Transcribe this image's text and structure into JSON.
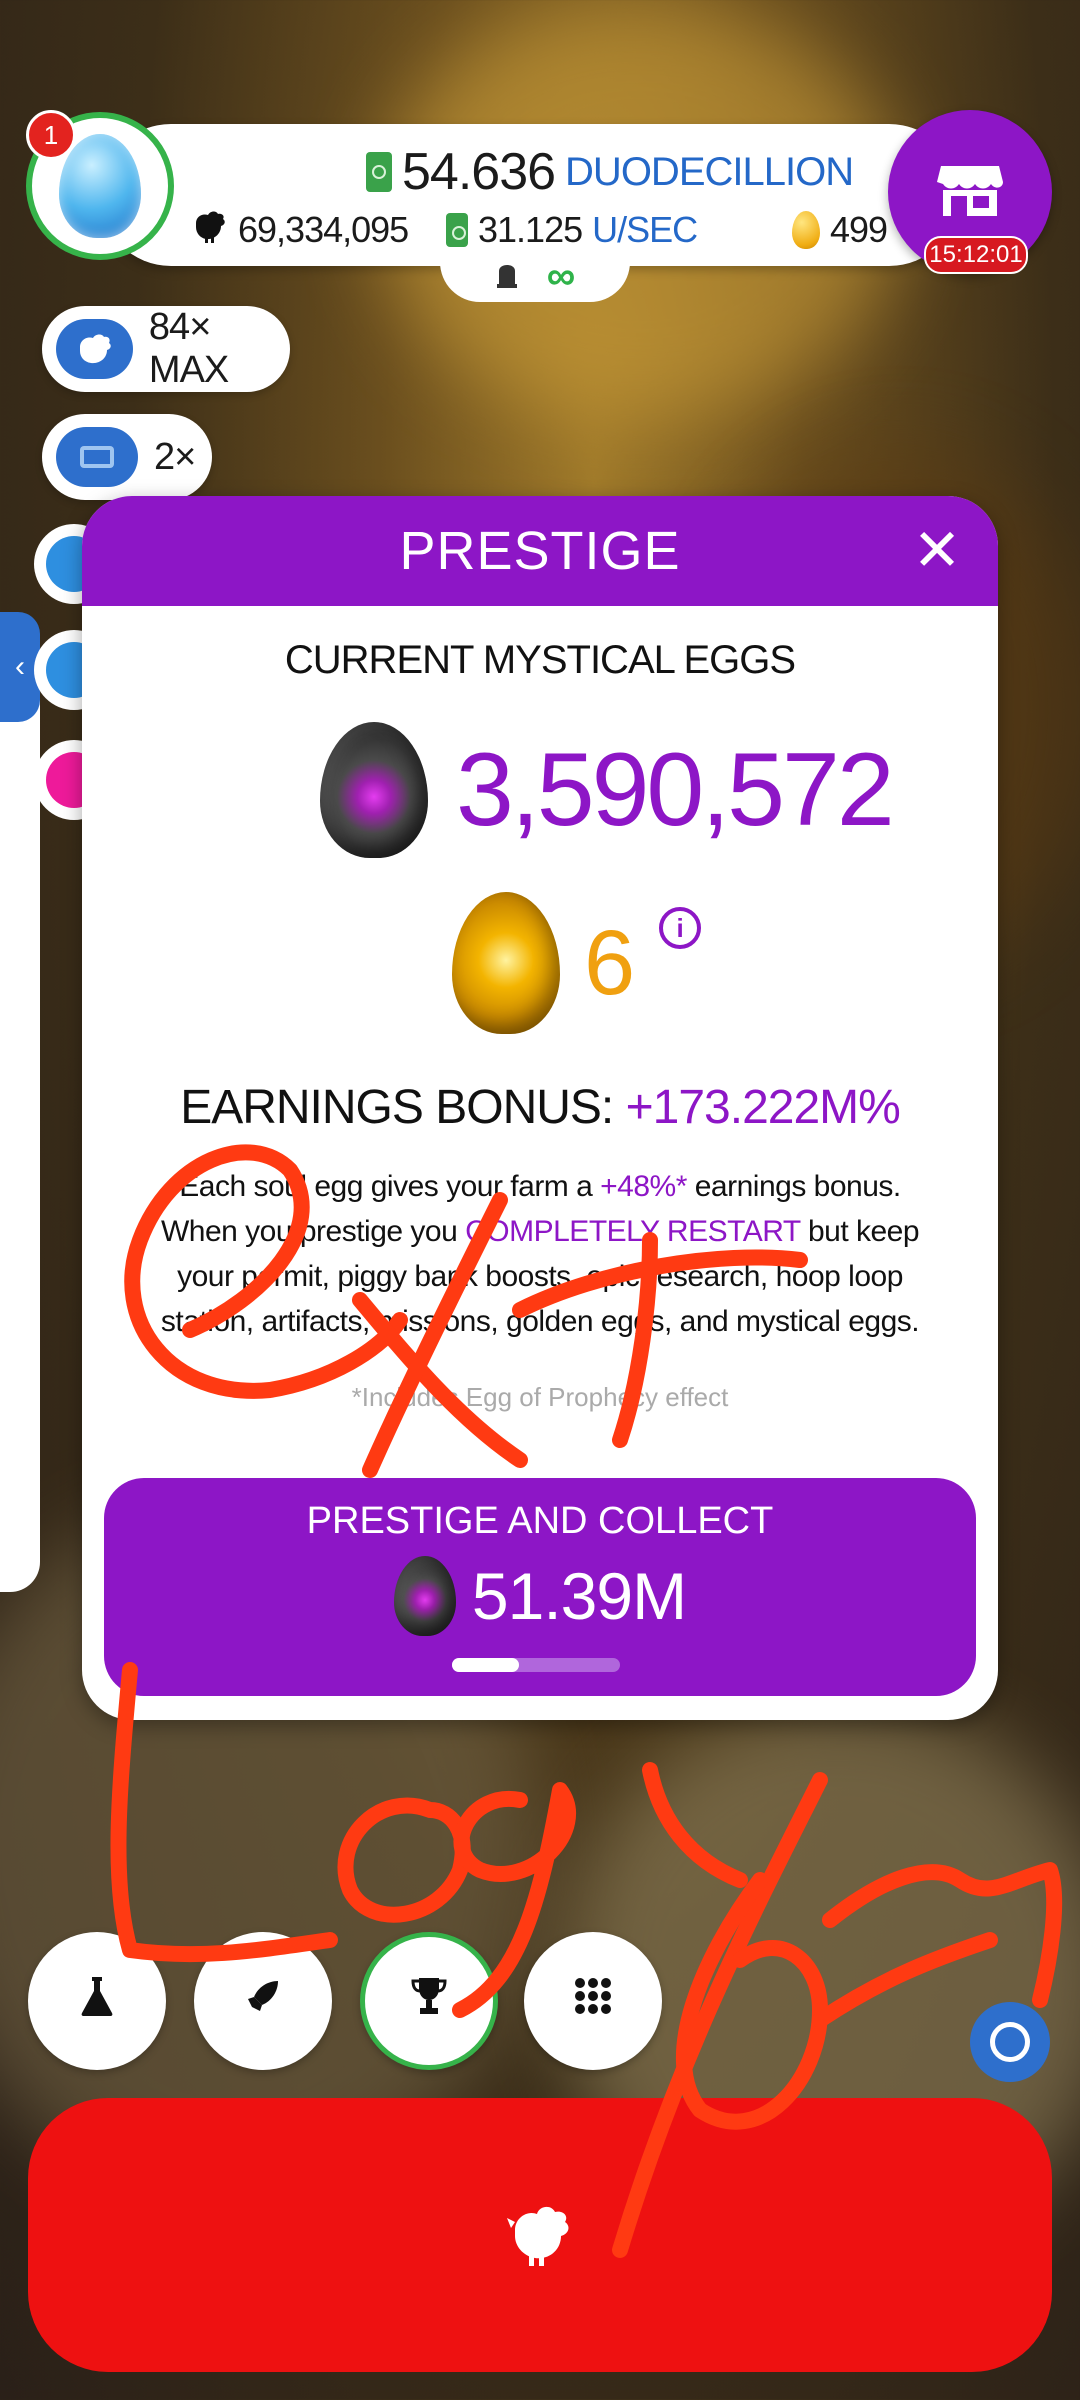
{
  "hud": {
    "notification_count": "1",
    "cash_value": "54.636",
    "cash_unit": "DUODECILLION",
    "chickens": "69,334,095",
    "income_value": "31.125",
    "income_unit": "U/SEC",
    "golden_eggs": "499",
    "shop_timer": "15:12:01",
    "infinity_symbol": "∞"
  },
  "boosts": [
    {
      "label": "84× MAX"
    },
    {
      "label": "2×"
    }
  ],
  "modal": {
    "title": "PRESTIGE",
    "close": "✕",
    "section_label": "CURRENT MYSTICAL EGGS",
    "soul_eggs": "3,590,572",
    "eggs_of_prophecy": "6",
    "info": "i",
    "bonus_prefix": "EARNINGS BONUS: ",
    "bonus_value": "+173.222M%",
    "desc": {
      "l1a": "Each soul egg gives your farm a ",
      "l1b": "+48%*",
      "l1c": " earnings bonus.",
      "l2a": "When you prestige you ",
      "l2b": "COMPLETELY RESTART",
      "l2c": " but keep",
      "l3": "your permit, piggy bank boosts, epic research, hoop loop",
      "l4": "station, artifacts, missions, golden eggs, and mystical eggs."
    },
    "footnote": "*Includes Egg of Prophecy effect",
    "collect_label": "PRESTIGE AND COLLECT",
    "collect_value": "51.39M",
    "collect_progress": 0.4
  },
  "colors": {
    "purple": "#8d16c6",
    "hatch_red": "#ee1111",
    "scribble": "#ff3a12"
  },
  "bottom_nav": [
    {
      "icon": "flask-icon"
    },
    {
      "icon": "rocket-icon"
    },
    {
      "icon": "trophy-icon"
    },
    {
      "icon": "grid-icon"
    }
  ],
  "scribble_text": [
    "Exp",
    "Losym"
  ]
}
